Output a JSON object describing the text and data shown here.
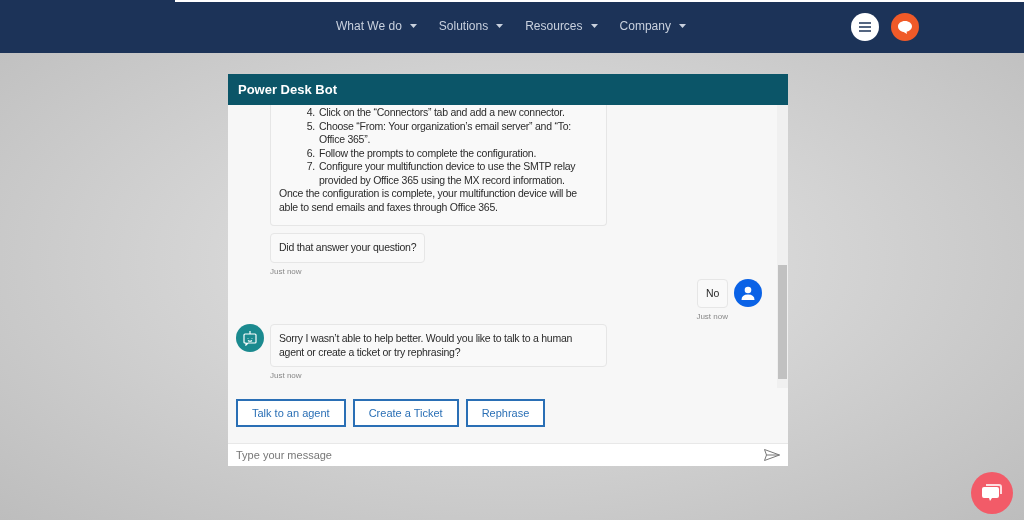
{
  "nav": {
    "items": [
      {
        "label": "What We do"
      },
      {
        "label": "Solutions"
      },
      {
        "label": "Resources"
      },
      {
        "label": "Company"
      }
    ]
  },
  "chat": {
    "title": "Power Desk Bot",
    "groups": [
      {
        "kind": "bot",
        "avatar": false,
        "time": "Just now",
        "bubbles": [
          {
            "kind": "list",
            "items": [
              {
                "number": "4.",
                "text": "Click on the “Connectors” tab and add a new connector."
              },
              {
                "number": "5.",
                "text": "Choose “From: Your organization’s email server” and “To: Office 365”."
              },
              {
                "number": "6.",
                "text": "Follow the prompts to complete the configuration."
              },
              {
                "number": "7.",
                "text": "Configure your multifunction device to use the SMTP relay provided by Office 365 using the MX record information."
              }
            ],
            "text": "Once the configuration is complete, your multifunction device will be able to send emails and faxes through Office 365."
          },
          {
            "kind": "text",
            "text": "Did that answer your question?"
          }
        ]
      },
      {
        "kind": "user",
        "avatar": true,
        "time": "Just now",
        "bubbles": [
          {
            "kind": "text",
            "text": "No"
          }
        ]
      },
      {
        "kind": "bot",
        "avatar": true,
        "time": "Just now",
        "bubbles": [
          {
            "kind": "text",
            "text": "Sorry I wasn’t able to help better. Would you like to talk to a human agent or create a ticket or try rephrasing?"
          }
        ]
      }
    ],
    "suggestions": [
      "Talk to an agent",
      "Create a Ticket",
      "Rephrase"
    ],
    "input": {
      "placeholder": "Type your message"
    }
  }
}
